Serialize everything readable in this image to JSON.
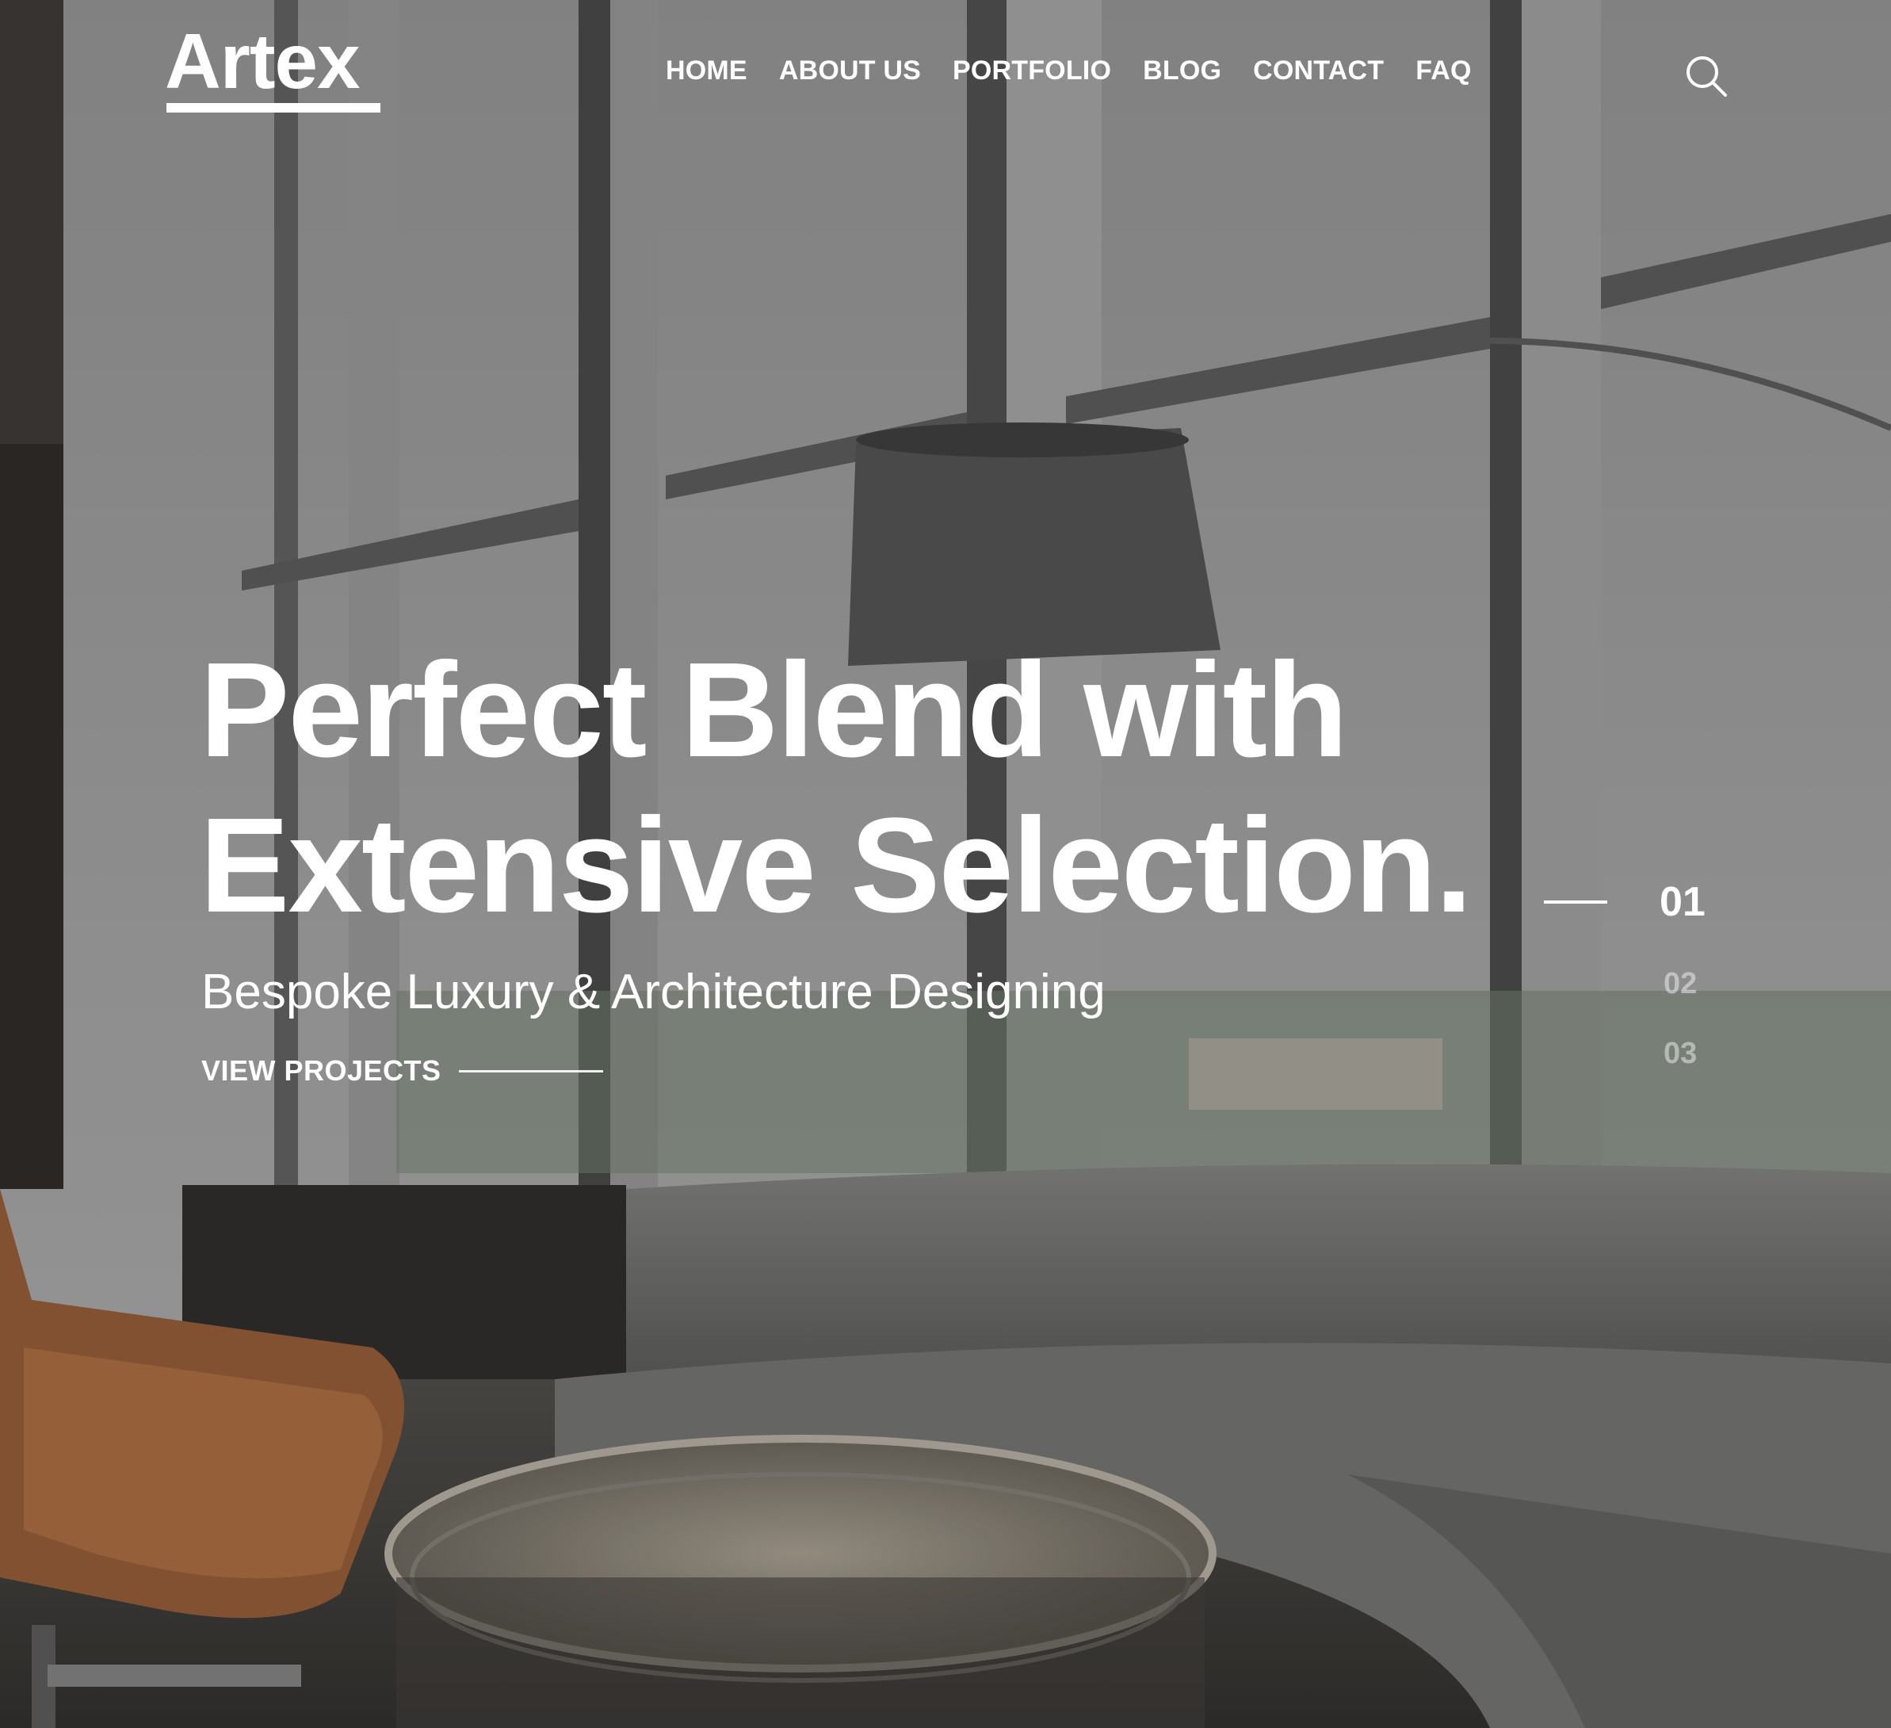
{
  "header": {
    "logo": "Artex",
    "nav": [
      "HOME",
      "ABOUT US",
      "PORTFOLIO",
      "BLOG",
      "CONTACT",
      "FAQ"
    ]
  },
  "hero": {
    "headline_line1": "Perfect Blend with",
    "headline_line2": "Extensive Selection.",
    "subtitle": "Bespoke Luxury & Architecture Designing",
    "cta_label": "VIEW PROJECTS"
  },
  "slider": {
    "current": "01",
    "slides": [
      "01",
      "02",
      "03"
    ]
  },
  "icons": {
    "search": "search-icon"
  },
  "colors": {
    "text": "#ffffff",
    "overlay": "#6f6f6f",
    "chair": "#8a5634"
  }
}
